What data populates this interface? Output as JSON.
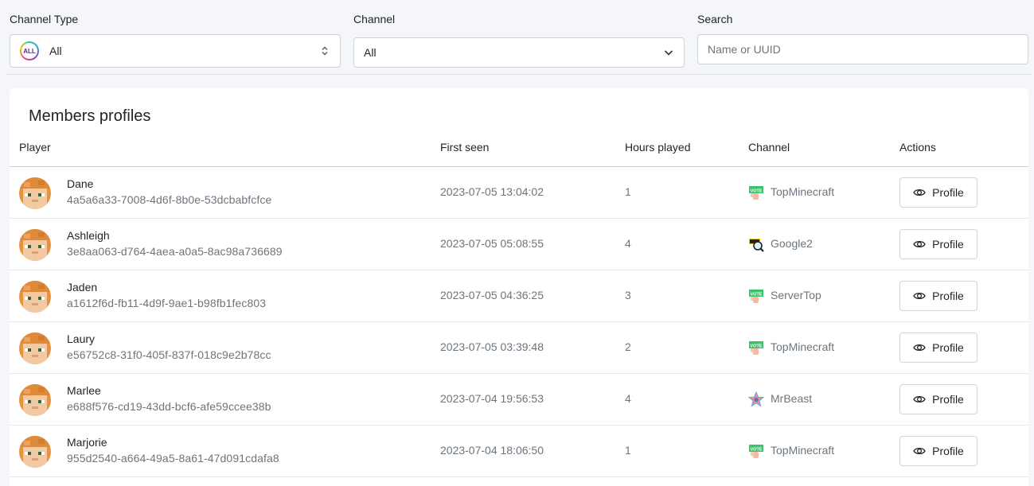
{
  "filters": {
    "channel_type": {
      "label": "Channel Type",
      "value": "All",
      "badge": "ALL"
    },
    "channel": {
      "label": "Channel",
      "value": "All"
    },
    "search": {
      "label": "Search",
      "placeholder": "Name or UUID",
      "value": ""
    }
  },
  "table": {
    "title": "Members profiles",
    "columns": {
      "player": "Player",
      "first_seen": "First seen",
      "hours": "Hours played",
      "channel": "Channel",
      "actions": "Actions"
    },
    "action_label": "Profile",
    "rows": [
      {
        "name": "Dane",
        "uuid": "4a5a6a33-7008-4d6f-8b0e-53dcbabfcfce",
        "first_seen": "2023-07-05 13:04:02",
        "hours": "1",
        "channel": "TopMinecraft",
        "channel_icon": "vote-icon"
      },
      {
        "name": "Ashleigh",
        "uuid": "3e8aa063-d764-4aea-a0a5-8ac98a736689",
        "first_seen": "2023-07-05 05:08:55",
        "hours": "4",
        "channel": "Google2",
        "channel_icon": "search-magnifier-icon"
      },
      {
        "name": "Jaden",
        "uuid": "a1612f6d-fb11-4d9f-9ae1-b98fb1fec803",
        "first_seen": "2023-07-05 04:36:25",
        "hours": "3",
        "channel": "ServerTop",
        "channel_icon": "vote-icon"
      },
      {
        "name": "Laury",
        "uuid": "e56752c8-31f0-405f-837f-018c9e2b78cc",
        "first_seen": "2023-07-05 03:39:48",
        "hours": "2",
        "channel": "TopMinecraft",
        "channel_icon": "vote-icon"
      },
      {
        "name": "Marlee",
        "uuid": "e688f576-cd19-43dd-bcf6-afe59ccee38b",
        "first_seen": "2023-07-04 19:56:53",
        "hours": "4",
        "channel": "MrBeast",
        "channel_icon": "star-icon"
      },
      {
        "name": "Marjorie",
        "uuid": "955d2540-a664-49a5-8a61-47d091cdafa8",
        "first_seen": "2023-07-04 18:06:50",
        "hours": "1",
        "channel": "TopMinecraft",
        "channel_icon": "vote-icon"
      }
    ]
  }
}
